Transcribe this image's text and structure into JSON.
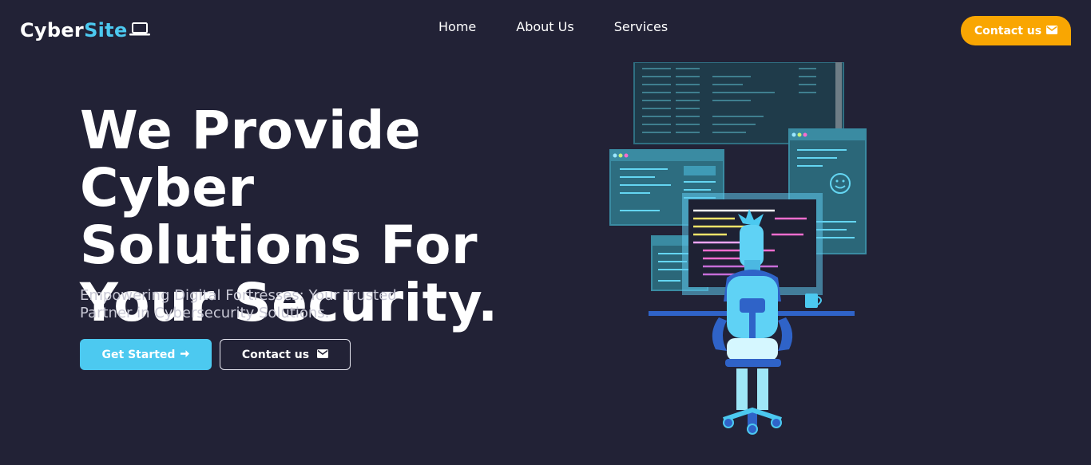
{
  "brand": {
    "part1": "Cyber",
    "part2": "Site",
    "icon": "laptop-icon"
  },
  "nav": {
    "items": [
      "Home",
      "About Us",
      "Services"
    ]
  },
  "header_cta": {
    "label": "Contact us",
    "icon": "envelope-icon"
  },
  "hero": {
    "title_lines": [
      "We Provide Cyber",
      "Solutions For",
      "Your Security."
    ],
    "subtitle": "Empowering Digital Fortresses: Your Trusted Partner in Cybersecurity Solutions.",
    "primary_button": {
      "label": "Get Started",
      "icon": "arrow-right-icon"
    },
    "secondary_button": {
      "label": "Contact us",
      "icon": "envelope-icon"
    }
  },
  "colors": {
    "background": "#222236",
    "accent": "#4cc9f0",
    "cta": "#f9a602",
    "text": "#ffffff",
    "muted_text": "#c9c9d6"
  }
}
